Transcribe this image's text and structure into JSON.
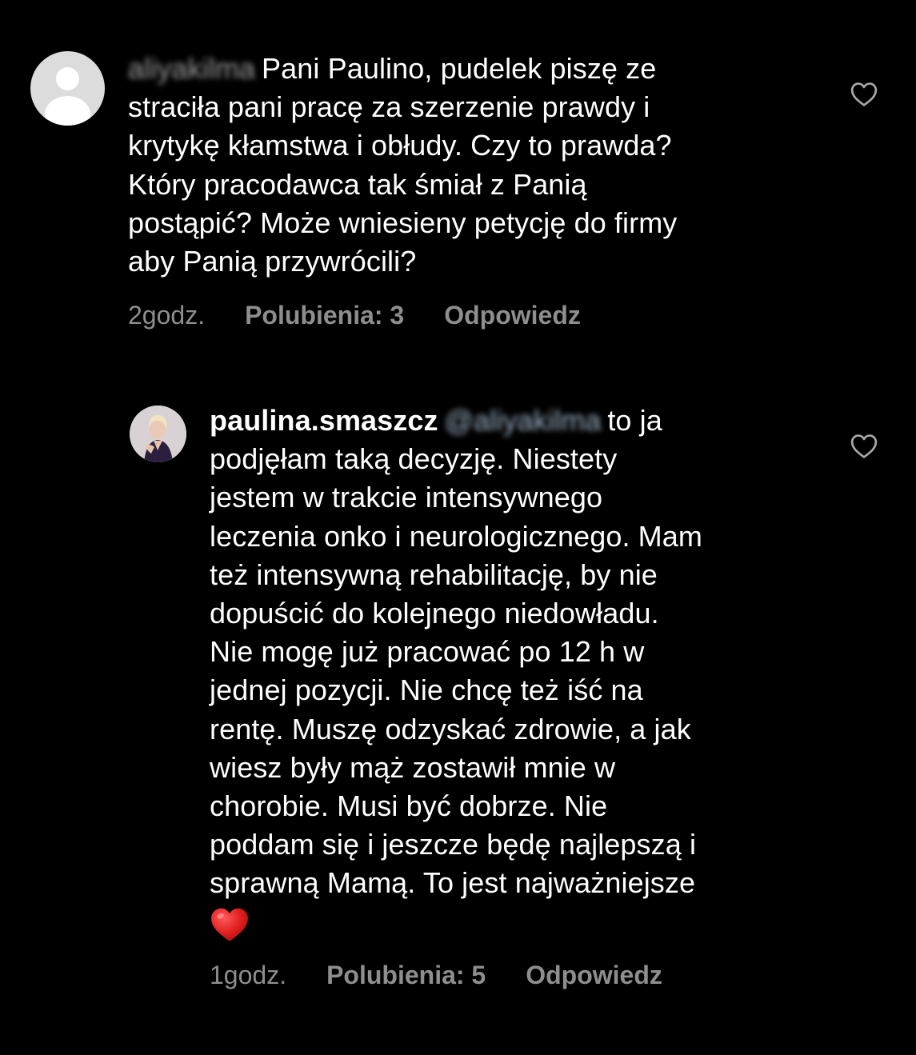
{
  "colors": {
    "background": "#000000",
    "text": "#ffffff",
    "meta": "#8e8e8e",
    "emoji_heart": "#e0201f"
  },
  "comments": [
    {
      "username_blurred": "aliyakilma",
      "lines": [
        "Pani Paulino, pudelek piszę ze",
        "straciła pani pracę za szerzenie prawdy i",
        "krytykę kłamstwa i obłudy. Czy to prawda?",
        "Który pracodawca tak śmiał z Panią",
        "postąpić? Może wniesieny petycję do firmy",
        "aby Panią przywrócili?"
      ],
      "time": "2godz.",
      "likes": "Polubienia: 3",
      "reply": "Odpowiedz",
      "avatar_icon": "default-avatar-icon",
      "like_icon": "heart-outline-icon"
    },
    {
      "username": "paulina.smaszcz",
      "mention_blurred": "@aliyakilma",
      "first_line_rest": "to ja",
      "lines": [
        "podjęłam taką decyzję. Niestety",
        "jestem w trakcie intensywnego",
        "leczenia onko i neurologicznego. Mam",
        "też intensywną rehabilitację, by nie",
        "dopuścić do kolejnego niedowładu.",
        "Nie mogę już pracować po 12 h w",
        "jednej pozycji. Nie chcę też iść na",
        "rentę. Muszę odzyskać zdrowie, a jak",
        "wiesz były mąż zostawił mnie w",
        "chorobie. Musi być dobrze. Nie",
        "poddam się i jeszcze będę najlepszą i",
        "sprawną Mamą. To jest najważniejsze"
      ],
      "emoji": "red-heart-emoji",
      "time": "1godz.",
      "likes": "Polubienia: 5",
      "reply": "Odpowiedz",
      "avatar_icon": "profile-photo-avatar",
      "like_icon": "heart-outline-icon"
    }
  ]
}
